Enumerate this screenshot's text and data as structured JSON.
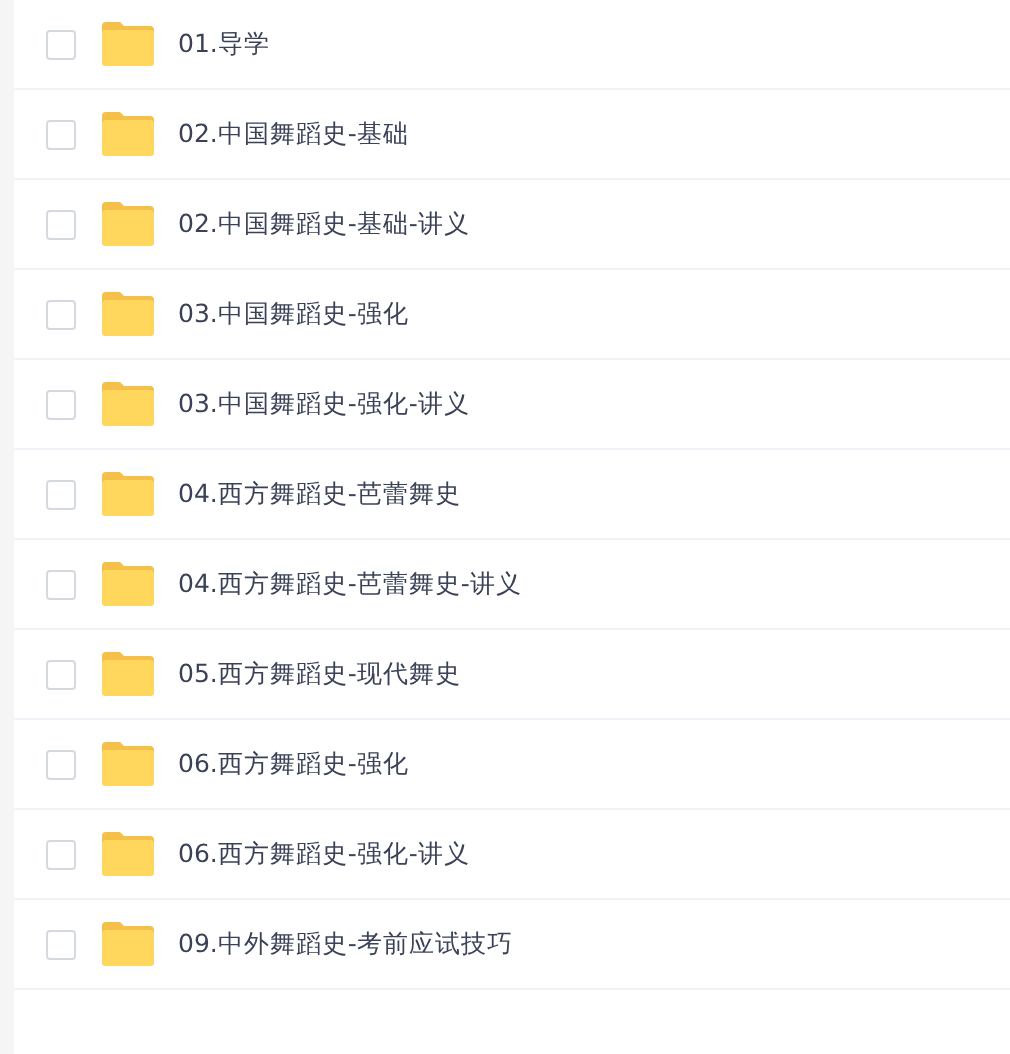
{
  "files": [
    {
      "name": "01.导学",
      "checked": false
    },
    {
      "name": "02.中国舞蹈史-基础",
      "checked": false
    },
    {
      "name": "02.中国舞蹈史-基础-讲义",
      "checked": false
    },
    {
      "name": "03.中国舞蹈史-强化",
      "checked": false
    },
    {
      "name": "03.中国舞蹈史-强化-讲义",
      "checked": false
    },
    {
      "name": "04.西方舞蹈史-芭蕾舞史",
      "checked": false
    },
    {
      "name": "04.西方舞蹈史-芭蕾舞史-讲义",
      "checked": false
    },
    {
      "name": "05.西方舞蹈史-现代舞史",
      "checked": false
    },
    {
      "name": "06.西方舞蹈史-强化",
      "checked": false
    },
    {
      "name": "06.西方舞蹈史-强化-讲义",
      "checked": false
    },
    {
      "name": "09.中外舞蹈史-考前应试技巧",
      "checked": false
    }
  ]
}
